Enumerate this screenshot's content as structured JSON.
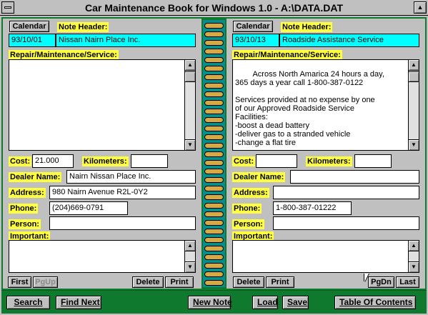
{
  "window": {
    "title": "Car Maintenance Book for Windows 1.0 - A:\\DATA.DAT",
    "maximize_icon": "▲"
  },
  "left_page": {
    "calendar_label": "Calendar",
    "note_header_label": "Note Header:",
    "date": "93/10/01",
    "note_header": "Nissan Nairn Place Inc.",
    "repair_label": "Repair/Maintenance/Service:",
    "repair_text": "",
    "cost_label": "Cost:",
    "cost": "21.000",
    "km_label": "Kilometers:",
    "km": "",
    "dealer_label": "Dealer Name:",
    "dealer": "Nairn Nissan Place Inc.",
    "address_label": "Address:",
    "address": "980 Nairn Avenue R2L-0Y2",
    "phone_label": "Phone:",
    "phone": "(204)669-0791",
    "person_label": "Person:",
    "person": "",
    "important_label": "Important:",
    "important": "",
    "first_label": "First",
    "pgup_label": "PgUp",
    "delete_label": "Delete",
    "print_label": "Print"
  },
  "right_page": {
    "calendar_label": "Calendar",
    "note_header_label": "Note Header:",
    "date": "93/10/13",
    "note_header": "Roadside Assistance Service",
    "repair_label": "Repair/Maintenance/Service:",
    "repair_text": "Across North Amarica 24 hours a day,\n365 days a year call 1-800-387-0122\n\nServices provided at no expense by one\nof our Approved Roadside Service\nFacilities:\n-boost a dead battery\n-deliver gas to a stranded vehicle\n-change a flat tire",
    "cost_label": "Cost:",
    "cost": "",
    "km_label": "Kilometers:",
    "km": "",
    "dealer_label": "Dealer Name:",
    "dealer": "",
    "address_label": "Address:",
    "address": "",
    "phone_label": "Phone:",
    "phone": "1-800-387-01222",
    "person_label": "Person:",
    "person": "",
    "important_label": "Important:",
    "important": "",
    "delete_label": "Delete",
    "print_label": "Print",
    "pgdn_label": "PgDn",
    "last_label": "Last"
  },
  "toolbar": {
    "search": "Search",
    "find_next": "Find Next",
    "new_note": "New Note",
    "load": "Load",
    "save": "Save",
    "toc": "Table Of Contents"
  },
  "scroll_icons": {
    "up": "▲",
    "down": "▼"
  }
}
